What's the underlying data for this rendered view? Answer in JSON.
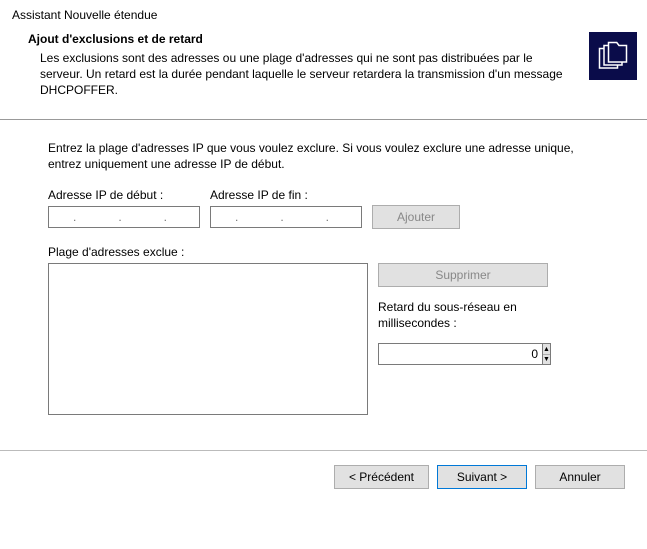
{
  "title": "Assistant Nouvelle étendue",
  "header": {
    "title": "Ajout d'exclusions et de retard",
    "description": "Les exclusions sont des adresses ou une plage d'adresses qui ne sont pas distribuées par le serveur. Un retard est la durée pendant laquelle le serveur retardera la transmission d'un message DHCPOFFER."
  },
  "body": {
    "intro": "Entrez la plage d'adresses IP que vous voulez exclure. Si vous voulez exclure une adresse unique, entrez uniquement une adresse IP de début.",
    "start_ip_label": "Adresse IP de début :",
    "start_ip_value": "",
    "end_ip_label": "Adresse IP de fin :",
    "end_ip_value": "",
    "add_button": "Ajouter",
    "excluded_label": "Plage d'adresses exclue :",
    "remove_button": "Supprimer",
    "delay_label": "Retard du sous-réseau en millisecondes :",
    "delay_value": "0"
  },
  "footer": {
    "back": "< Précédent",
    "next": "Suivant >",
    "cancel": "Annuler"
  },
  "ip_placeholder": ".   .   ."
}
